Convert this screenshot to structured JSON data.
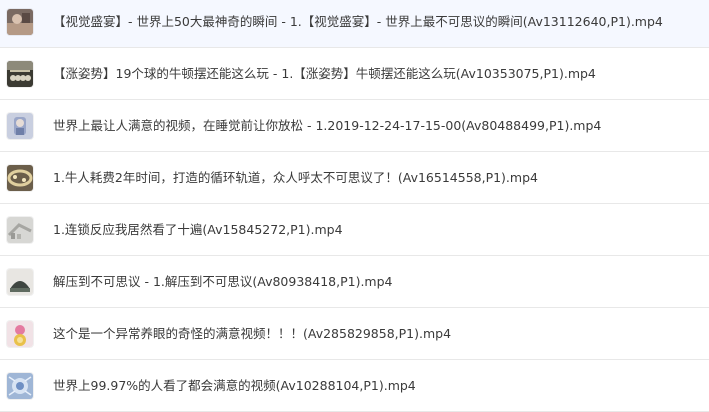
{
  "files": [
    {
      "name": "【视觉盛宴】- 世界上50大最神奇的瞬间 - 1.【视觉盛宴】- 世界上最不可思议的瞬间(Av13112640,P1).mp4",
      "thumbnail_icon": "video-thumbnail-icon"
    },
    {
      "name": "【涨姿势】19个球的牛顿摆还能这么玩 - 1.【涨姿势】牛顿摆还能这么玩(Av10353075,P1).mp4",
      "thumbnail_icon": "video-thumbnail-icon"
    },
    {
      "name": "世界上最让人满意的视频，在睡觉前让你放松 - 1.2019-12-24-17-15-00(Av80488499,P1).mp4",
      "thumbnail_icon": "video-thumbnail-icon"
    },
    {
      "name": "1.牛人耗费2年时间，打造的循环轨道，众人呼太不可思议了！(Av16514558,P1).mp4",
      "thumbnail_icon": "video-thumbnail-icon"
    },
    {
      "name": "1.连锁反应我居然看了十遍(Av15845272,P1).mp4",
      "thumbnail_icon": "video-thumbnail-icon"
    },
    {
      "name": "解压到不可思议 - 1.解压到不可思议(Av80938418,P1).mp4",
      "thumbnail_icon": "video-thumbnail-icon"
    },
    {
      "name": "这个是一个异常养眼的奇怪的满意视频！！！(Av285829858,P1).mp4",
      "thumbnail_icon": "video-thumbnail-icon"
    },
    {
      "name": "世界上99.97%的人看了都会满意的视频(Av10288104,P1).mp4",
      "thumbnail_icon": "video-thumbnail-icon"
    }
  ]
}
